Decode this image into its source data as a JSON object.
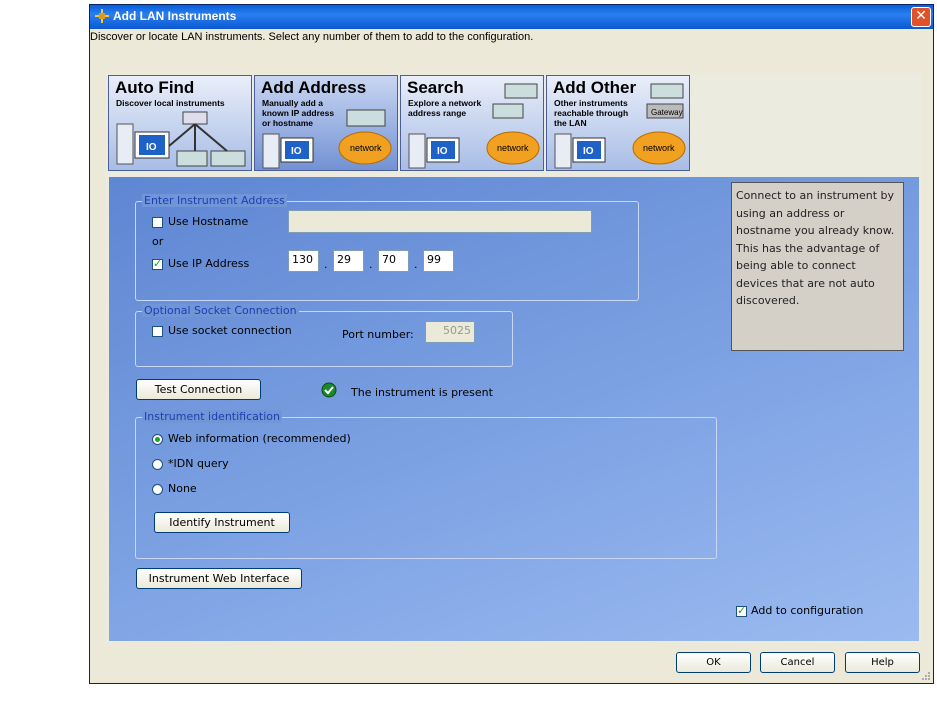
{
  "window": {
    "title": "Add LAN Instruments",
    "description": "Discover or locate LAN instruments. Select any number of them to add to the configuration."
  },
  "tabs": [
    {
      "title": "Auto Find",
      "subtitle": "Discover local instruments"
    },
    {
      "title": "Add Address",
      "subtitle": "Manually add a known IP address or hostname",
      "badge": "network"
    },
    {
      "title": "Search",
      "subtitle": "Explore a network address range",
      "badge": "network"
    },
    {
      "title": "Add Other",
      "subtitle": "Other instruments reachable through the LAN",
      "badge": "network",
      "gateway": "Gateway"
    }
  ],
  "address_group": {
    "legend": "Enter Instrument Address",
    "use_hostname_label": "Use Hostname",
    "or_label": "or",
    "use_ip_label": "Use IP Address",
    "ip": [
      "130",
      "29",
      "70",
      "99"
    ],
    "dot": "."
  },
  "socket_group": {
    "legend": "Optional Socket Connection",
    "use_socket_label": "Use socket connection",
    "port_label": "Port number:",
    "port_value": "5025"
  },
  "test": {
    "button": "Test Connection",
    "status": "The instrument is present"
  },
  "ident_group": {
    "legend": "Instrument identification",
    "options": [
      "Web information (recommended)",
      "*IDN query",
      "None"
    ],
    "identify_button": "Identify Instrument"
  },
  "web_interface_button": "Instrument Web Interface",
  "info_text": "Connect to an instrument by using an address or hostname you already know. This has the advantage of being able to connect devices that are not auto discovered.",
  "add_to_config_label": "Add to configuration",
  "footer": {
    "ok": "OK",
    "cancel": "Cancel",
    "help": "Help"
  },
  "tab_icon_label": "IO"
}
